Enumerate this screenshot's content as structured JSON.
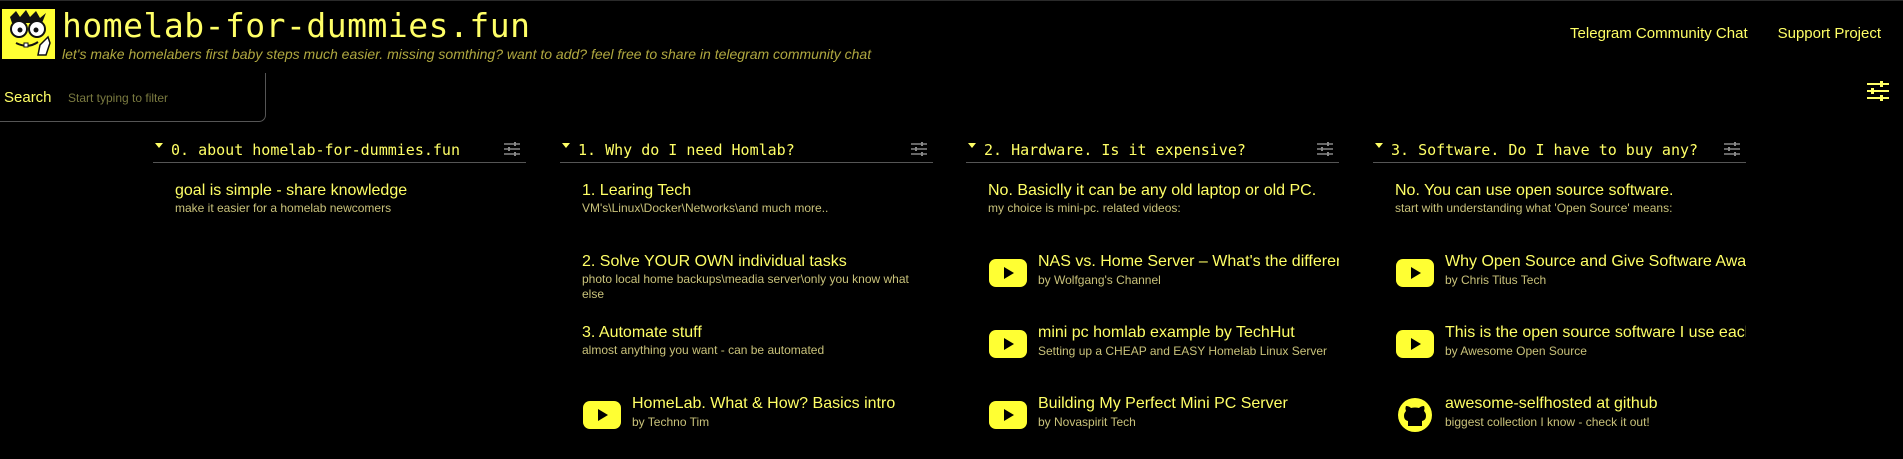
{
  "header": {
    "title": "homelab-for-dummies.fun",
    "subtitle": "let's make homelabers first baby steps much easier. missing somthing? want to add? feel free to share in telegram community chat",
    "links": [
      "Telegram Community Chat",
      "Support Project"
    ]
  },
  "search": {
    "label": "Search",
    "placeholder": "Start typing to filter"
  },
  "colors": {
    "accent": "#ffff66",
    "muted": "#c9c27a",
    "background": "#000000"
  },
  "columns": [
    {
      "title": "0. about homelab-for-dummies.fun",
      "items": [
        {
          "title": "goal is simple - share knowledge",
          "desc": "make it easier for a homelab newcomers"
        }
      ]
    },
    {
      "title": "1. Why do I need Homlab?",
      "items": [
        {
          "title": "1. Learing Tech",
          "desc": "VM's\\Linux\\Docker\\Networks\\and much more.."
        },
        {
          "title": "2. Solve YOUR OWN individual tasks",
          "desc": "photo local home backups\\meadia server\\only you know what else"
        },
        {
          "title": "3. Automate stuff",
          "desc": "almost anything you want - can be automated"
        },
        {
          "icon": "youtube-icon",
          "title": "HomeLab. What & How? Basics intro",
          "desc": "by Techno Tim"
        }
      ]
    },
    {
      "title": "2. Hardware. Is it expensive?",
      "items": [
        {
          "title": "No. Basiclly it can be any old laptop or old PC.",
          "desc": "my choice is mini-pc. related videos:"
        },
        {
          "icon": "youtube-icon",
          "title": "NAS vs. Home Server – What's the difference?",
          "desc": "by Wolfgang's Channel"
        },
        {
          "icon": "youtube-icon",
          "title": "mini pc homlab example by TechHut",
          "desc": "Setting up a CHEAP and EASY Homelab Linux Server"
        },
        {
          "icon": "youtube-icon",
          "title": "Building My Perfect Mini PC Server",
          "desc": "by Novaspirit Tech"
        }
      ]
    },
    {
      "title": "3. Software. Do I have to buy any?",
      "items": [
        {
          "title": "No. You can use open source software.",
          "desc": "start with understanding what 'Open Source' means:"
        },
        {
          "icon": "youtube-icon",
          "title": "Why Open Source and Give Software Away?",
          "desc": "by Chris Titus Tech"
        },
        {
          "icon": "youtube-icon",
          "title": "This is the open source software I use each day",
          "desc": "by Awesome Open Source"
        },
        {
          "icon": "github-icon",
          "title": "awesome-selfhosted at github",
          "desc": "biggest collection I know - check it out!"
        }
      ]
    }
  ]
}
